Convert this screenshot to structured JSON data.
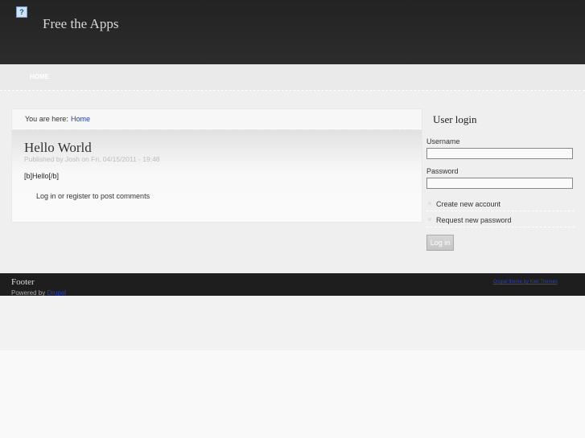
{
  "header": {
    "site_name": "Free the Apps",
    "logo_glyph": "?"
  },
  "nav": {
    "items": [
      {
        "label": "HOME"
      }
    ]
  },
  "breadcrumb": {
    "label": "You are here:",
    "crumb": "Home"
  },
  "node": {
    "title": "Hello World",
    "submitted": "Published by Josh on Fri, 04/15/2011 - 19:48",
    "body": "[b]Hello[/b]",
    "links": "Log in or register to post comments"
  },
  "sidebar": {
    "block_title": "User login",
    "username_label": "Username",
    "password_label": "Password",
    "username_value": "",
    "password_value": "",
    "links": [
      "Create new account",
      "Request new password"
    ],
    "submit_label": "Log in"
  },
  "footer": {
    "title": "Footer",
    "powered_prefix": "Powered by",
    "powered_link": "Drupal",
    "right_link": "Drupal theme by Kiwi Themes"
  },
  "colors": {
    "link": "#1d3fbf",
    "header_bg": "#232323",
    "footer_bg": "#1e1e1e"
  }
}
